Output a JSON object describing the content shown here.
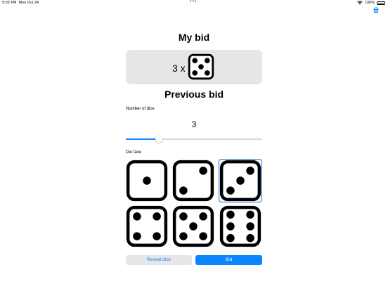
{
  "status_bar": {
    "time": "5:02 PM",
    "date": "Mon Oct 24",
    "dots": "•••",
    "battery_text": "100%"
  },
  "my_bid": {
    "title": "My bid",
    "count_text": "3 x",
    "face": 5
  },
  "previous_bid": {
    "title": "Previous bid"
  },
  "number_of_dice": {
    "label": "Number of dice",
    "value": "3",
    "slider_fraction": 0.24
  },
  "die_face": {
    "label": "Die face",
    "faces": [
      1,
      2,
      3,
      4,
      5,
      6
    ],
    "selected": 3
  },
  "buttons": {
    "reveal_label": "Reveal dice",
    "bid_label": "Bid"
  },
  "colors": {
    "accent": "#0a84ff",
    "box_bg": "#e6e6e8",
    "selected_outline": "#2a6fd8"
  },
  "icons": {
    "wifi": "wifi-icon",
    "battery": "battery-icon",
    "home": "home-icon"
  }
}
